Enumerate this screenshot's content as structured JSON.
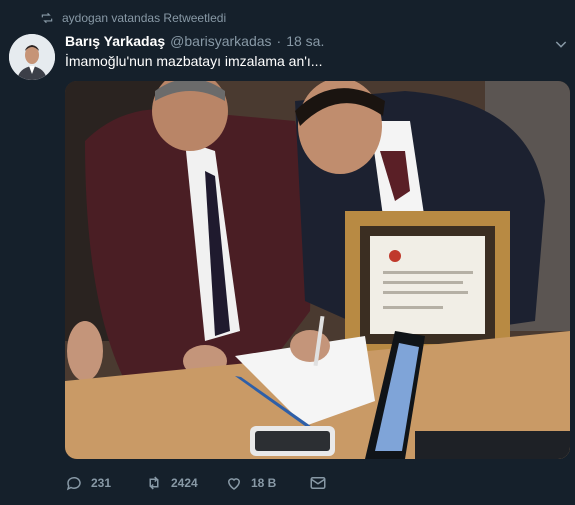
{
  "retweet_notice": "aydogan vatandas Retweetledi",
  "tweet": {
    "author_name": "Barış Yarkadaş",
    "author_handle": "@barisyarkadas",
    "separator": "·",
    "time": "18 sa.",
    "text": "İmamoğlu'nun mazbatayı imzalama an'ı..."
  },
  "actions": {
    "reply_count": "231",
    "retweet_count": "2424",
    "like_count": "18 B"
  },
  "colors": {
    "background": "#15202b",
    "secondary_text": "#8899a6",
    "primary_text": "#ffffff"
  },
  "icons": {
    "retweet": "retweet-icon",
    "caret": "chevron-down-icon",
    "reply": "reply-icon",
    "like": "heart-icon",
    "dm": "mail-icon"
  }
}
